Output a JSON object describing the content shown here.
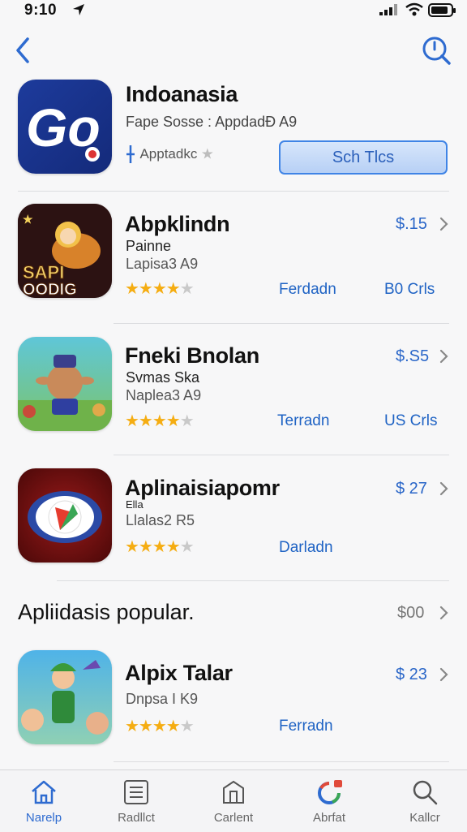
{
  "status_bar": {
    "time": "9:10"
  },
  "featured": {
    "title": "Indoanasia",
    "subtitle": "Fape Sosse : AppdadĐ A9",
    "developer": "Apptadkc",
    "button_label": "Sch Tlcs"
  },
  "apps": [
    {
      "title": "Abpklindn",
      "line1": "Painne",
      "line2": "Lapisa3 A9",
      "price": "$.15",
      "link1": "Ferdadn",
      "link2": "B0 Crls",
      "rating": 4
    },
    {
      "title": "Fneki Bnolan",
      "line1": "Svmas Ska",
      "line2": "Naplea3 A9",
      "price": "$.S5",
      "link1": "Terradn",
      "link2": "US Crls",
      "rating": 4
    },
    {
      "title": "Aplinaisiapomr",
      "line1": "Ella",
      "line2": "Llalas2 R5",
      "price": "$ 27",
      "link1": "Darladn",
      "rating": 4
    }
  ],
  "section": {
    "title": "Apliidasis popular.",
    "value": "$00"
  },
  "popular_app": {
    "title": "Alpix Talar",
    "line2": "Dnpsa I K9",
    "price": "$ 23",
    "link1": "Ferradn",
    "rating": 4
  },
  "tabs": [
    {
      "label": "Narelp",
      "icon": "home-icon"
    },
    {
      "label": "Radllct",
      "icon": "list-icon"
    },
    {
      "label": "Carlent",
      "icon": "layers-icon"
    },
    {
      "label": "Abrfat",
      "icon": "apps-icon"
    },
    {
      "label": "Kallcr",
      "icon": "search-icon"
    }
  ],
  "colors": {
    "accent": "#2e6bd0",
    "star": "#f5ad12",
    "background": "#f7f7f8"
  }
}
